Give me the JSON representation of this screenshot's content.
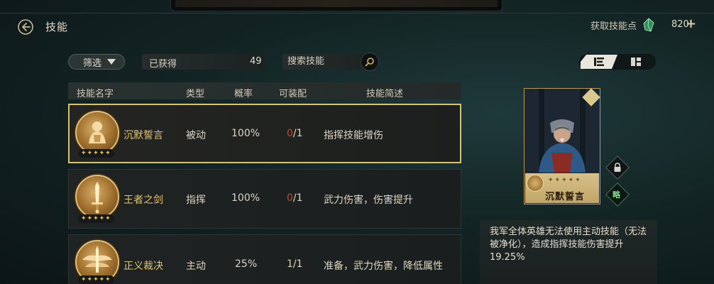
{
  "header": {
    "title": "技能",
    "get_points_label": "获取技能点",
    "points_value": "820",
    "plus_symbol": "+"
  },
  "toolbar": {
    "filter_label": "筛选",
    "owned_label": "已获得",
    "owned_count": "49",
    "search_placeholder": "搜索技能"
  },
  "table": {
    "columns": [
      "技能名字",
      "类型",
      "概率",
      "可装配",
      "技能简述"
    ],
    "rows": [
      {
        "name": "沉默誓言",
        "type": "被动",
        "rate": "100%",
        "uses_current": "0",
        "uses_total": "/1",
        "summary": "指挥技能增伤",
        "stars": "✦✦✦✦✦",
        "selected": true
      },
      {
        "name": "王者之剑",
        "type": "指挥",
        "rate": "100%",
        "uses_current": "0",
        "uses_total": "/1",
        "summary": "武力伤害，伤害提升",
        "stars": "✦✦✦✦✦",
        "selected": false
      },
      {
        "name": "正义裁决",
        "type": "主动",
        "rate": "25%",
        "uses_current": "1",
        "uses_total": "/1",
        "summary": "准备，武力伤害，降低属性",
        "stars": "✦✦✦✦✦",
        "selected": false
      }
    ]
  },
  "detail": {
    "card_name": "沉默誓言",
    "card_stars": "✦✦✦✦✦",
    "strategy_label": "略",
    "description": "我军全体英雄无法使用主动技能（无法被净化），造成指挥技能伤害提升19.25%"
  },
  "colors": {
    "accent_gold": "#d9c46a",
    "skill_name": "#e6c56a",
    "uses_zero": "#c4482b",
    "strategy_green": "#7ee08a"
  }
}
